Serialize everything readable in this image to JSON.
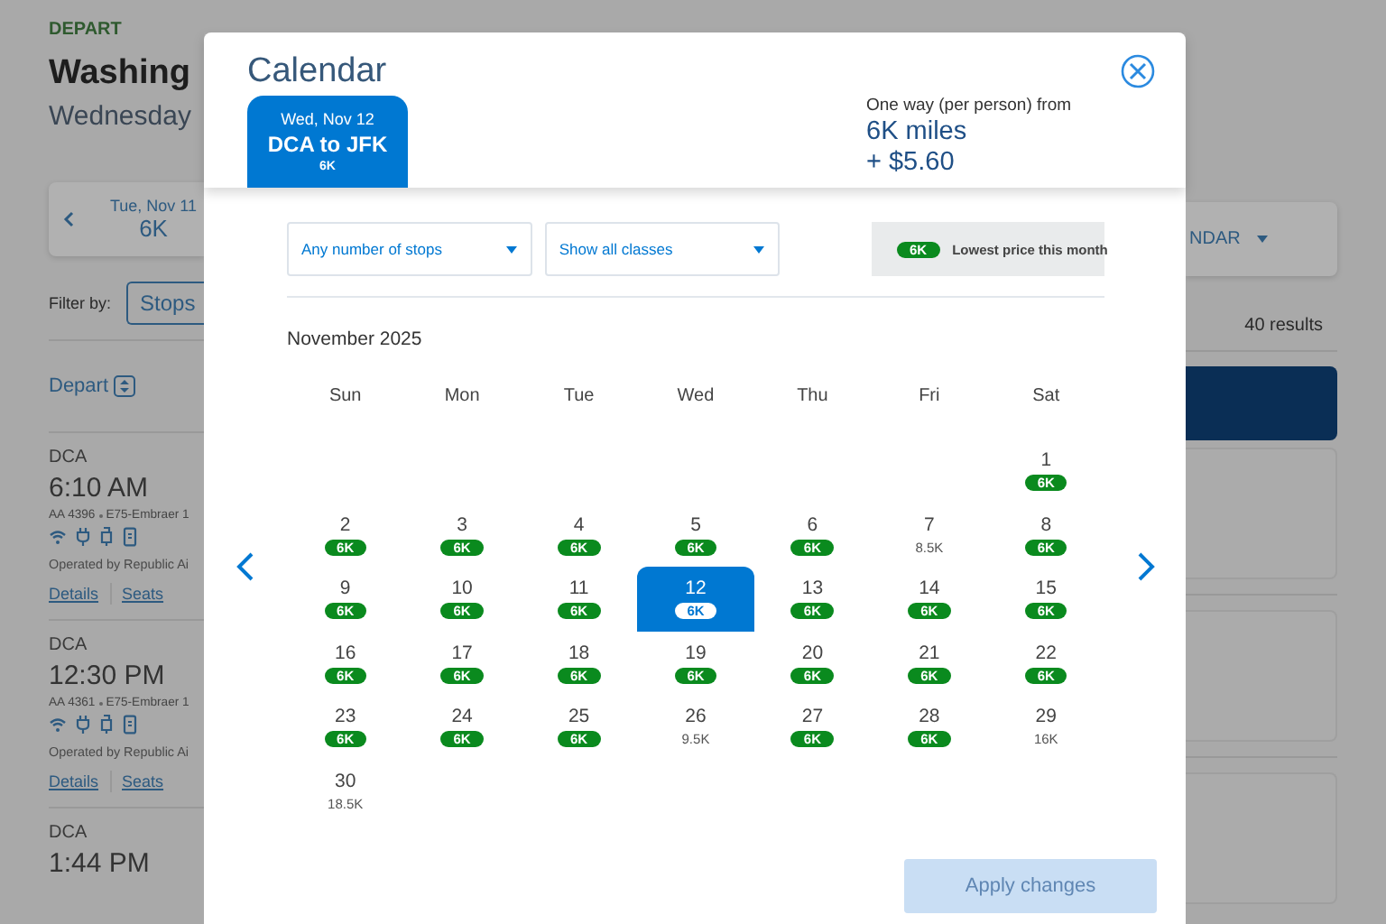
{
  "page": {
    "section_label": "DEPART",
    "title": "Washing",
    "subtitle": "Wednesday",
    "date_card": {
      "date": "Tue, Nov 11",
      "price": "6K",
      "calendar_label": "NDAR"
    },
    "filter": {
      "label": "Filter by:",
      "button": "Stops"
    },
    "sort": {
      "label": "Depart"
    },
    "results_count": "40 results",
    "flights": [
      {
        "origin": "DCA",
        "time": "6:10 AM",
        "flight": "AA 4396",
        "aircraft": "E75-Embraer 1",
        "operator": "Operated by Republic Ai",
        "links": [
          "Details",
          "Seats"
        ]
      },
      {
        "origin": "DCA",
        "time": "12:30 PM",
        "flight": "AA 4361",
        "aircraft": "E75-Embraer 1",
        "operator": "Operated by Republic Ai",
        "links": [
          "Details",
          "Seats"
        ]
      },
      {
        "origin": "DCA",
        "time": "1:44 PM"
      }
    ]
  },
  "calendar": {
    "title": "Calendar",
    "trip_tab": {
      "date": "Wed, Nov 12",
      "route": "DCA to JFK",
      "price": "6K",
      "selected": true
    },
    "fare": {
      "label": "One way (per person) from",
      "miles": "6K miles",
      "fee": "+ $5.60"
    },
    "stops_filter": {
      "value": "Any number of stops"
    },
    "class_filter": {
      "value": "Show all classes"
    },
    "legend": {
      "badge": "6K",
      "label": "Lowest price this month"
    },
    "month": "November 2025",
    "weekdays": [
      "Sun",
      "Mon",
      "Tue",
      "Wed",
      "Thu",
      "Fri",
      "Sat"
    ],
    "weeks": [
      [
        {
          "day": "1",
          "price": "6K",
          "lowest": true,
          "selected": false
        }
      ],
      [
        {
          "day": "2",
          "price": "6K",
          "lowest": true,
          "selected": false
        },
        {
          "day": "3",
          "price": "6K",
          "lowest": true,
          "selected": false
        },
        {
          "day": "4",
          "price": "6K",
          "lowest": true,
          "selected": false
        },
        {
          "day": "5",
          "price": "6K",
          "lowest": true,
          "selected": false
        },
        {
          "day": "6",
          "price": "6K",
          "lowest": true,
          "selected": false
        },
        {
          "day": "7",
          "price": "8.5K",
          "lowest": false,
          "selected": false
        },
        {
          "day": "8",
          "price": "6K",
          "lowest": true,
          "selected": false
        }
      ],
      [
        {
          "day": "9",
          "price": "6K",
          "lowest": true,
          "selected": false
        },
        {
          "day": "10",
          "price": "6K",
          "lowest": true,
          "selected": false
        },
        {
          "day": "11",
          "price": "6K",
          "lowest": true,
          "selected": false
        },
        {
          "day": "12",
          "price": "6K",
          "lowest": true,
          "selected": true
        },
        {
          "day": "13",
          "price": "6K",
          "lowest": true,
          "selected": false
        },
        {
          "day": "14",
          "price": "6K",
          "lowest": true,
          "selected": false
        },
        {
          "day": "15",
          "price": "6K",
          "lowest": true,
          "selected": false
        }
      ],
      [
        {
          "day": "16",
          "price": "6K",
          "lowest": true,
          "selected": false
        },
        {
          "day": "17",
          "price": "6K",
          "lowest": true,
          "selected": false
        },
        {
          "day": "18",
          "price": "6K",
          "lowest": true,
          "selected": false
        },
        {
          "day": "19",
          "price": "6K",
          "lowest": true,
          "selected": false
        },
        {
          "day": "20",
          "price": "6K",
          "lowest": true,
          "selected": false
        },
        {
          "day": "21",
          "price": "6K",
          "lowest": true,
          "selected": false
        },
        {
          "day": "22",
          "price": "6K",
          "lowest": true,
          "selected": false
        }
      ],
      [
        {
          "day": "23",
          "price": "6K",
          "lowest": true,
          "selected": false
        },
        {
          "day": "24",
          "price": "6K",
          "lowest": true,
          "selected": false
        },
        {
          "day": "25",
          "price": "6K",
          "lowest": true,
          "selected": false
        },
        {
          "day": "26",
          "price": "9.5K",
          "lowest": false,
          "selected": false
        },
        {
          "day": "27",
          "price": "6K",
          "lowest": true,
          "selected": false
        },
        {
          "day": "28",
          "price": "6K",
          "lowest": true,
          "selected": false
        },
        {
          "day": "29",
          "price": "16K",
          "lowest": false,
          "selected": false
        }
      ],
      [
        {
          "day": "30",
          "price": "18.5K",
          "lowest": false,
          "selected": false
        }
      ]
    ],
    "apply_button": {
      "label": "Apply changes",
      "disabled": true
    }
  }
}
